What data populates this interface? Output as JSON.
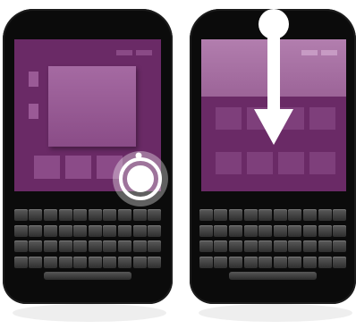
{
  "figure": {
    "panels": [
      {
        "id": "tap-gesture",
        "gesture_icon": "tap-touch-indicator-icon"
      },
      {
        "id": "swipe-down-gesture",
        "gesture_icon": "swipe-down-arrow-icon"
      }
    ],
    "colors": {
      "device_body": "#0b0b0b",
      "screen_purple": "#6a2a66",
      "screen_light": "#a36ca0",
      "tile": "#8b4b88",
      "key": "#3d3d3d",
      "gesture_indicator": "#ffffff"
    }
  }
}
